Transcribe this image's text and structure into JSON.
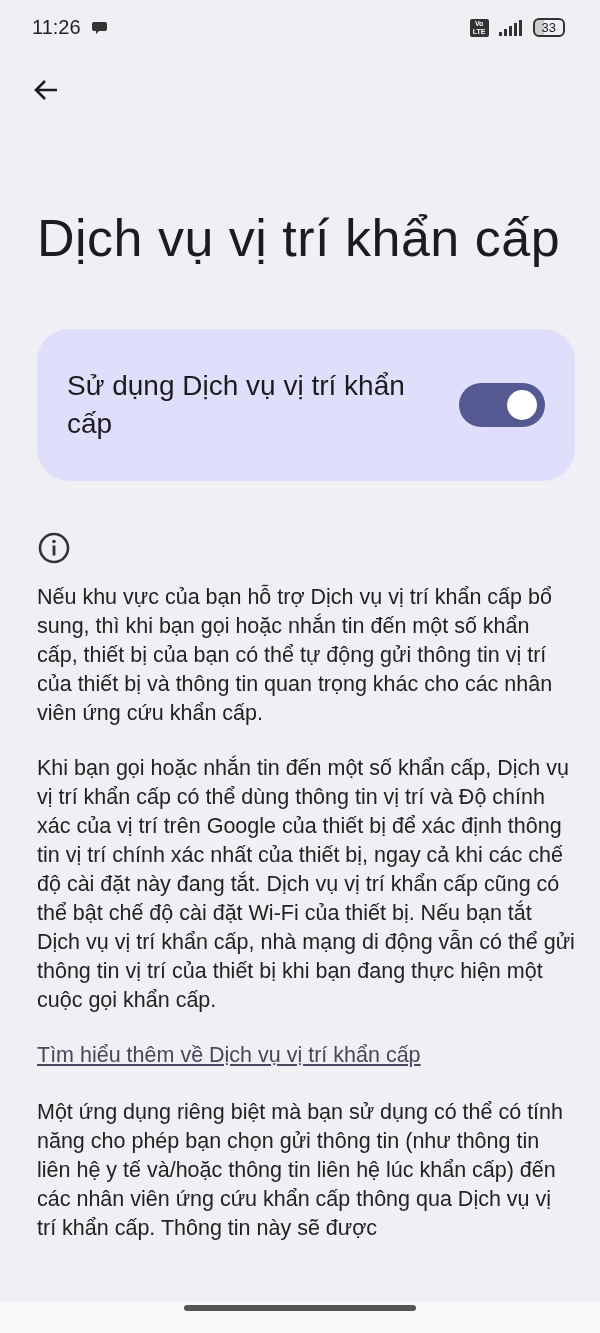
{
  "status_bar": {
    "time": "11:26",
    "battery": "33",
    "network_badge": [
      "Vo",
      "LTE"
    ]
  },
  "title": "Dịch vụ vị trí khẩn cấp",
  "setting": {
    "label": "Sử dụng Dịch vụ vị trí khẩn cấp",
    "on": true
  },
  "paragraphs": [
    {
      "kind": "text",
      "text": "Nếu khu vực của bạn hỗ trợ Dịch vụ vị trí khẩn cấp bổ sung, thì khi bạn gọi hoặc nhắn tin đến một số khẩn cấp, thiết bị của bạn có thể tự động gửi thông tin vị trí của thiết bị và thông tin quan trọng khác cho các nhân viên ứng cứu khẩn cấp."
    },
    {
      "kind": "text",
      "text": "Khi bạn gọi hoặc nhắn tin đến một số khẩn cấp, Dịch vụ vị trí khẩn cấp có thể dùng thông tin vị trí và Độ chính xác của vị trí trên Google của thiết bị để xác định thông tin vị trí chính xác nhất của thiết bị, ngay cả khi các chế độ cài đặt này đang tắt. Dịch vụ vị trí khẩn cấp cũng có thể bật chế độ cài đặt Wi-Fi của thiết bị. Nếu bạn tắt Dịch vụ vị trí khẩn cấp, nhà mạng di động vẫn có thể gửi thông tin vị trí của thiết bị khi bạn đang thực hiện một cuộc gọi khẩn cấp."
    },
    {
      "kind": "link",
      "text": "Tìm hiểu thêm về Dịch vụ vị trí khẩn cấp"
    },
    {
      "kind": "text",
      "text": "Một ứng dụng riêng biệt mà bạn sử dụng có thể có tính năng cho phép bạn chọn gửi thông tin (như thông tin liên hệ y tế và/hoặc thông tin liên hệ lúc khẩn cấp) đến các nhân viên ứng cứu khẩn cấp thông qua Dịch vụ vị trí khẩn cấp. Thông tin này sẽ được"
    }
  ]
}
